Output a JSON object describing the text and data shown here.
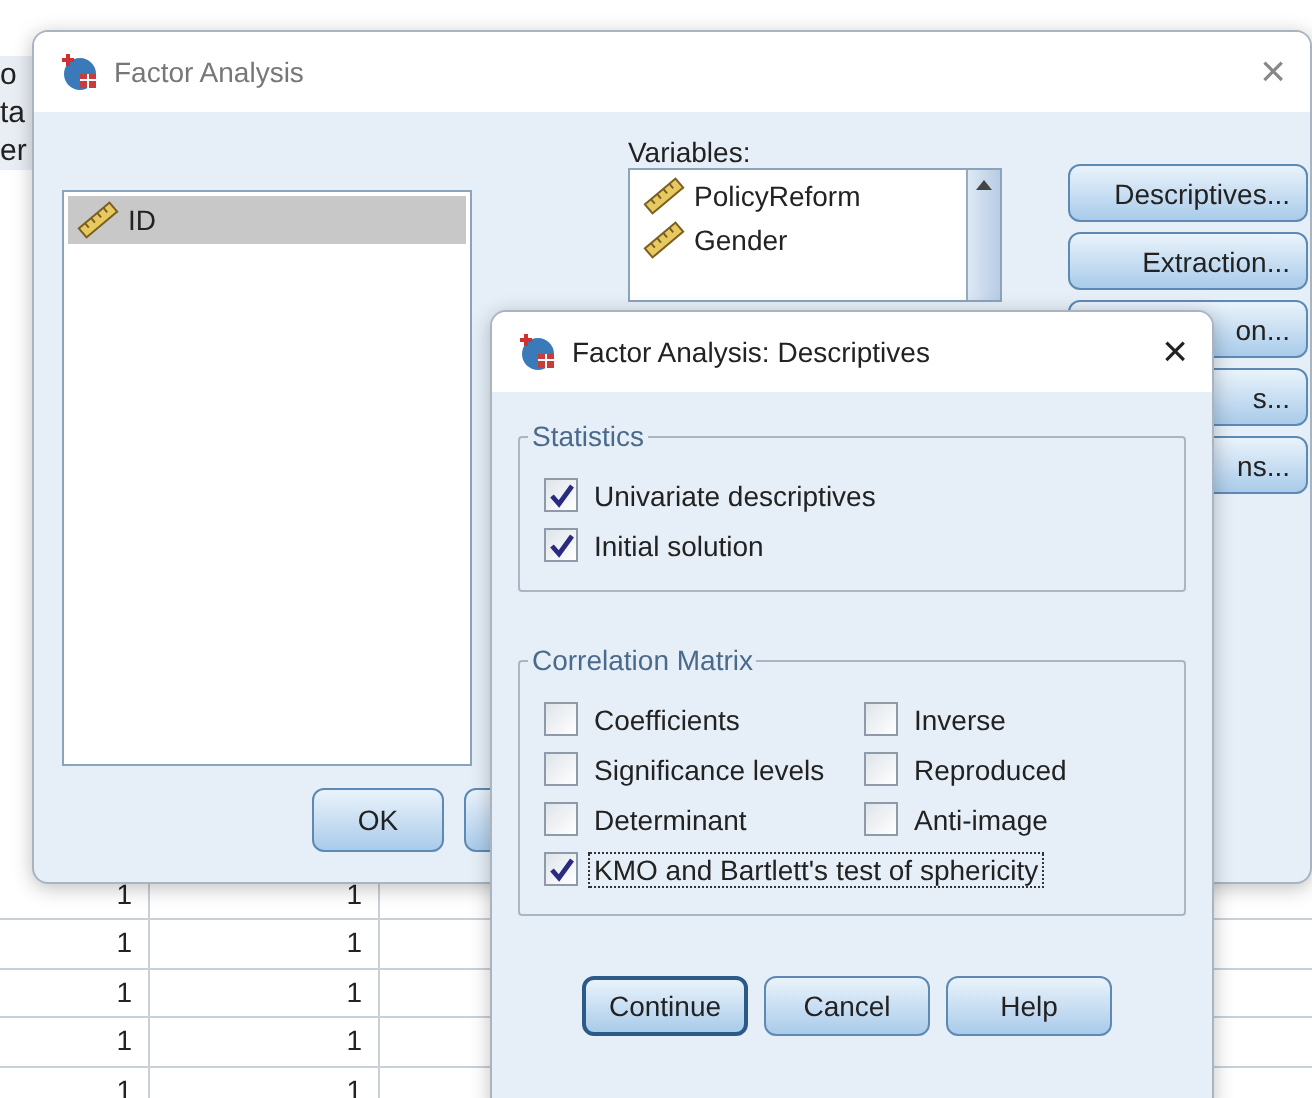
{
  "background": {
    "edge_texts": [
      "o",
      "ta",
      "er"
    ],
    "rows": [
      [
        "1",
        "1"
      ],
      [
        "1",
        "1"
      ],
      [
        "1",
        "1"
      ],
      [
        "1",
        "1"
      ],
      [
        "1",
        "1"
      ]
    ]
  },
  "main_window": {
    "title": "Factor Analysis",
    "close": "×",
    "source_list": [
      {
        "label": "ID",
        "selected": true
      }
    ],
    "variables_label": "Variables:",
    "variables": [
      {
        "label": "PolicyReform"
      },
      {
        "label": "Gender"
      }
    ],
    "side_buttons": [
      "Descriptives...",
      "Extraction...",
      "on...",
      "s...",
      "ns..."
    ],
    "bottom_buttons": [
      "OK"
    ]
  },
  "dialog": {
    "title": "Factor Analysis: Descriptives",
    "close": "×",
    "statistics": {
      "title": "Statistics",
      "items": [
        {
          "label": "Univariate descriptives",
          "checked": true
        },
        {
          "label": "Initial solution",
          "checked": true
        }
      ]
    },
    "correlation_matrix": {
      "title": "Correlation Matrix",
      "items": [
        {
          "label": "Coefficients",
          "checked": false
        },
        {
          "label": "Inverse",
          "checked": false
        },
        {
          "label": "Significance levels",
          "checked": false
        },
        {
          "label": "Reproduced",
          "checked": false
        },
        {
          "label": "Determinant",
          "checked": false
        },
        {
          "label": "Anti-image",
          "checked": false
        }
      ],
      "wide_item": {
        "label": "KMO and Bartlett's test of sphericity",
        "checked": true,
        "focused": true
      }
    },
    "buttons": [
      {
        "label": "Continue",
        "default": true
      },
      {
        "label": "Cancel",
        "default": false
      },
      {
        "label": "Help",
        "default": false
      }
    ]
  }
}
